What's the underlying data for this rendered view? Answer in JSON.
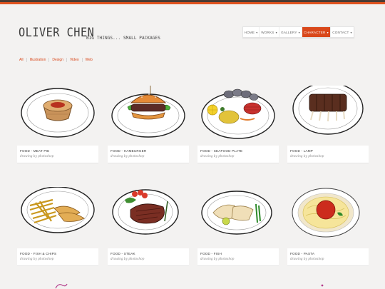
{
  "site": {
    "logo": "OLIVER CHEN",
    "tagline": "BIG THINGS... SMALL PACKAGES"
  },
  "nav": [
    {
      "label": "HOME",
      "dropdown": true,
      "active": false
    },
    {
      "label": "WORKS",
      "dropdown": true,
      "active": false
    },
    {
      "label": "GALLERY",
      "dropdown": true,
      "active": false
    },
    {
      "label": "CHARACTER",
      "dropdown": true,
      "active": true
    },
    {
      "label": "CONTACT",
      "dropdown": true,
      "active": false
    }
  ],
  "filters": [
    "All",
    "Illustration",
    "Design",
    "Video",
    "Web"
  ],
  "gallery": [
    {
      "title": "FOOD - MEAT PIE",
      "subtitle": "drawing by photoshop",
      "icon": "meat-pie-illustration"
    },
    {
      "title": "FOOD - HAMBURGER",
      "subtitle": "drawing by photoshop",
      "icon": "hamburger-illustration"
    },
    {
      "title": "FOOD - SEAFOOD PLATE",
      "subtitle": "drawing by photoshop",
      "icon": "seafood-plate-illustration"
    },
    {
      "title": "FOOD - LAMP",
      "subtitle": "drawing by photoshop",
      "icon": "lamb-ribs-illustration"
    },
    {
      "title": "FOOD - FISH & CHIPS",
      "subtitle": "drawing by photoshop",
      "icon": "fish-and-chips-illustration"
    },
    {
      "title": "FOOD - STEAK",
      "subtitle": "drawing by photoshop",
      "icon": "steak-illustration"
    },
    {
      "title": "FOOD - FISH",
      "subtitle": "drawing by photoshop",
      "icon": "fish-illustration"
    },
    {
      "title": "FOOD - PASTA",
      "subtitle": "drawing by photoshop",
      "icon": "pasta-illustration"
    }
  ],
  "colors": {
    "accent": "#d9481b",
    "topbar_dark": "#4a3b33",
    "topbar_orange": "#e0531f",
    "background": "#f3f2f1"
  }
}
